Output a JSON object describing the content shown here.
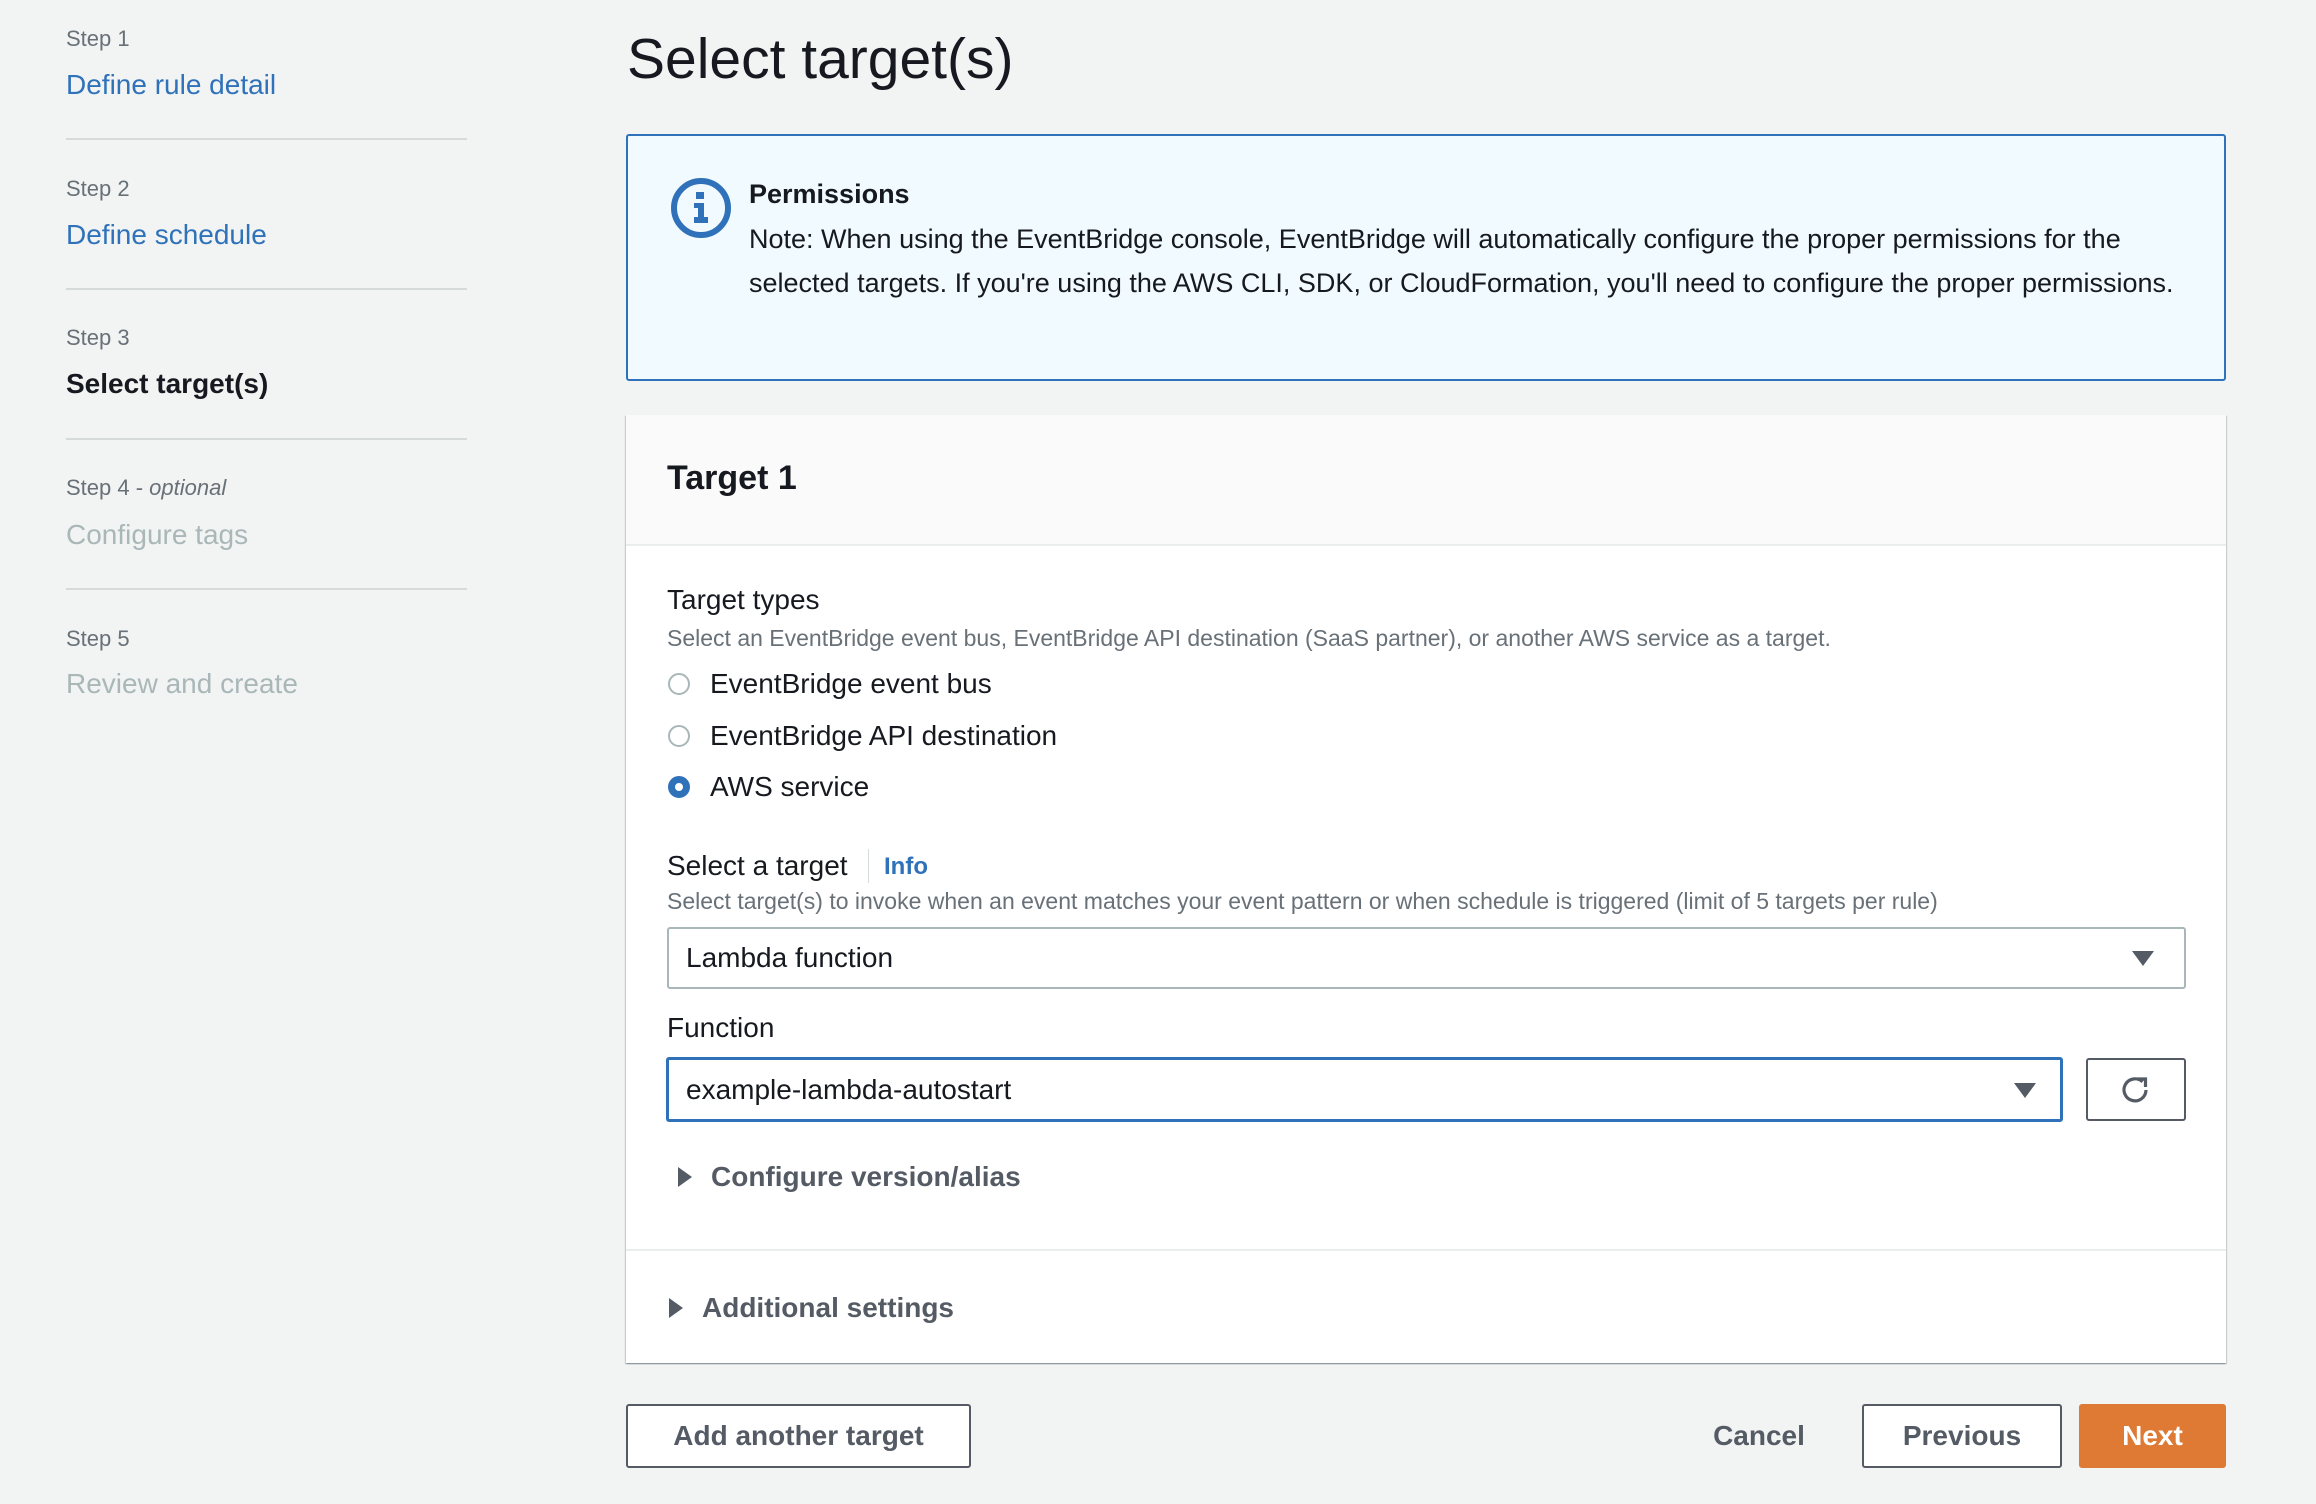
{
  "sidebar": {
    "steps": [
      {
        "label": "Step 1",
        "title": "Define rule detail",
        "state": "link"
      },
      {
        "label": "Step 2",
        "title": "Define schedule",
        "state": "link"
      },
      {
        "label": "Step 3",
        "title": "Select target(s)",
        "state": "active"
      },
      {
        "label": "Step 4",
        "label_suffix": "optional",
        "title": "Configure tags",
        "state": "disabled"
      },
      {
        "label": "Step 5",
        "title": "Review and create",
        "state": "disabled"
      }
    ]
  },
  "page": {
    "title": "Select target(s)"
  },
  "alert": {
    "icon": "info-icon",
    "title": "Permissions",
    "body": "Note: When using the EventBridge console, EventBridge will automatically configure the proper permissions for the selected targets. If you're using the AWS CLI, SDK, or CloudFormation, you'll need to configure the proper permissions."
  },
  "target": {
    "title": "Target 1",
    "target_types": {
      "label": "Target types",
      "description": "Select an EventBridge event bus, EventBridge API destination (SaaS partner), or another AWS service as a target.",
      "options": [
        {
          "label": "EventBridge event bus",
          "checked": false
        },
        {
          "label": "EventBridge API destination",
          "checked": false
        },
        {
          "label": "AWS service",
          "checked": true
        }
      ]
    },
    "select_target": {
      "label": "Select a target",
      "info_link": "Info",
      "description": "Select target(s) to invoke when an event matches your event pattern or when schedule is triggered (limit of 5 targets per rule)",
      "value": "Lambda function"
    },
    "function": {
      "label": "Function",
      "value": "example-lambda-autostart",
      "refresh_icon": "refresh-icon"
    },
    "configure_version": "Configure version/alias",
    "additional_settings": "Additional settings"
  },
  "footer": {
    "add_target": "Add another target",
    "cancel": "Cancel",
    "previous": "Previous",
    "next": "Next"
  },
  "colors": {
    "link": "#2f72ba",
    "primary_button": "#df7a35",
    "alert_background": "#f1faff",
    "page_background": "#f2f3f3"
  }
}
